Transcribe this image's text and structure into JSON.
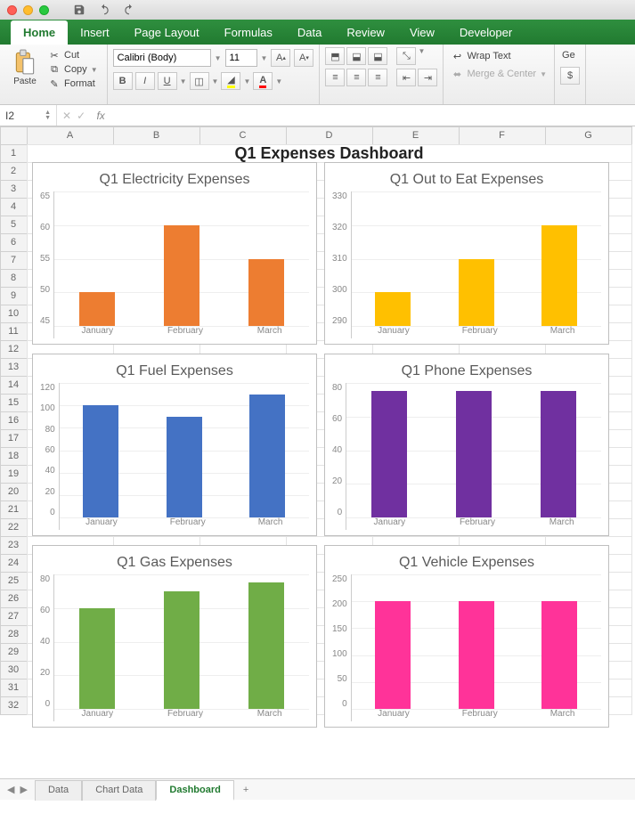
{
  "window": {
    "qat": {
      "save_icon": "save-icon",
      "undo_icon": "undo-icon",
      "redo_icon": "redo-icon"
    }
  },
  "ribbon": {
    "tabs": [
      "Home",
      "Insert",
      "Page Layout",
      "Formulas",
      "Data",
      "Review",
      "View",
      "Developer"
    ],
    "active_tab_index": 0,
    "clipboard": {
      "paste_label": "Paste",
      "cut_label": "Cut",
      "copy_label": "Copy",
      "format_label": "Format"
    },
    "font": {
      "name": "Calibri (Body)",
      "size": "11",
      "increase": "A▴",
      "decrease": "A▾",
      "bold": "B",
      "italic": "I",
      "underline": "U"
    },
    "alignment": {
      "wrap_label": "Wrap Text",
      "merge_label": "Merge & Center"
    },
    "number": {
      "general_label": "Ge",
      "currency": "$"
    }
  },
  "formula_bar": {
    "name_box": "I2",
    "fx": "fx",
    "value": ""
  },
  "columns": [
    "A",
    "B",
    "C",
    "D",
    "E",
    "F",
    "G"
  ],
  "rows": [
    "1",
    "2",
    "3",
    "4",
    "5",
    "6",
    "7",
    "8",
    "9",
    "10",
    "11",
    "12",
    "13",
    "14",
    "15",
    "16",
    "17",
    "18",
    "19",
    "20",
    "21",
    "22",
    "23",
    "24",
    "25",
    "26",
    "27",
    "28",
    "29",
    "30",
    "31",
    "32"
  ],
  "dashboard_title": "Q1 Expenses Dashboard",
  "sheet_tabs": [
    "Data",
    "Chart Data",
    "Dashboard"
  ],
  "active_sheet_index": 2,
  "add_sheet": "+",
  "chart_data": [
    {
      "type": "bar",
      "title": "Q1 Electricity Expenses",
      "categories": [
        "January",
        "February",
        "March"
      ],
      "values": [
        50,
        60,
        55
      ],
      "ylim": [
        45,
        65
      ],
      "ystep": 5,
      "color": "#ed7d31"
    },
    {
      "type": "bar",
      "title": "Q1 Out to Eat Expenses",
      "categories": [
        "January",
        "February",
        "March"
      ],
      "values": [
        300,
        310,
        320
      ],
      "ylim": [
        290,
        330
      ],
      "ystep": 10,
      "color": "#ffc000"
    },
    {
      "type": "bar",
      "title": "Q1 Fuel Expenses",
      "categories": [
        "January",
        "February",
        "March"
      ],
      "values": [
        100,
        90,
        110
      ],
      "ylim": [
        0,
        120
      ],
      "ystep": 20,
      "color": "#4472c4"
    },
    {
      "type": "bar",
      "title": "Q1 Phone Expenses",
      "categories": [
        "January",
        "February",
        "March"
      ],
      "values": [
        75,
        75,
        75
      ],
      "ylim": [
        0,
        80
      ],
      "ystep": 20,
      "color": "#7030a0"
    },
    {
      "type": "bar",
      "title": "Q1 Gas Expenses",
      "categories": [
        "January",
        "February",
        "March"
      ],
      "values": [
        60,
        70,
        75
      ],
      "ylim": [
        0,
        80
      ],
      "ystep": 20,
      "color": "#70ad47"
    },
    {
      "type": "bar",
      "title": "Q1 Vehicle Expenses",
      "categories": [
        "January",
        "February",
        "March"
      ],
      "values": [
        200,
        200,
        200
      ],
      "ylim": [
        0,
        250
      ],
      "ystep": 50,
      "color": "#ff3399"
    }
  ]
}
